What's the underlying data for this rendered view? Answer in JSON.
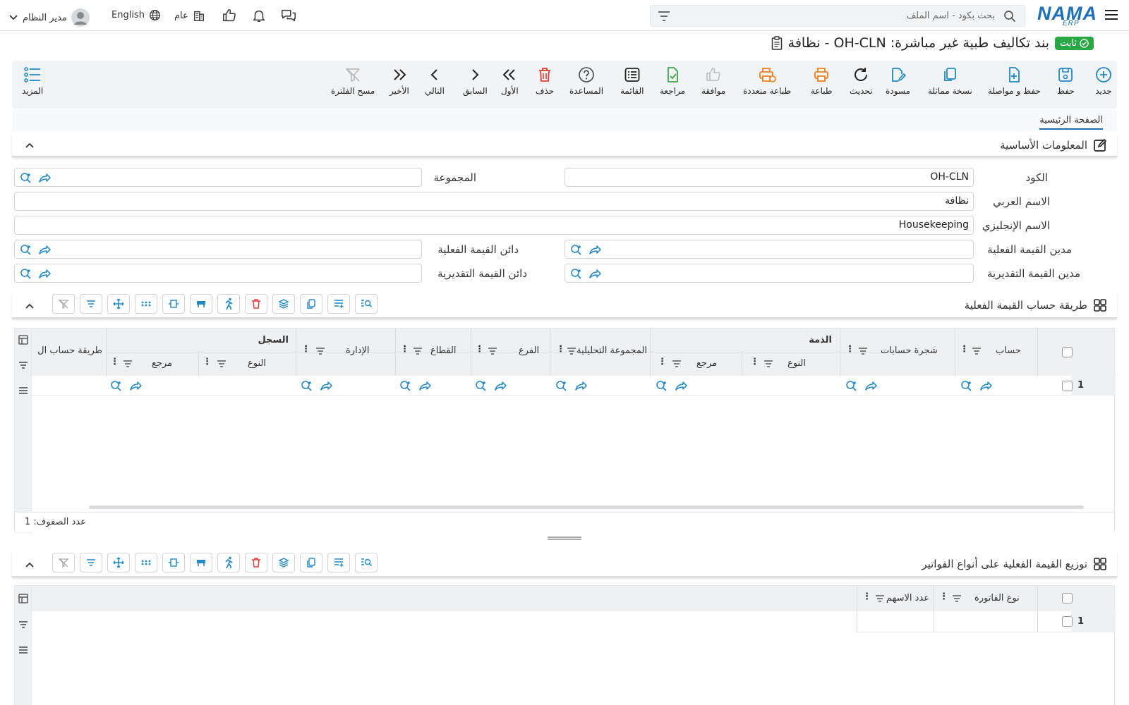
{
  "topbar": {
    "user": "مدير النظام",
    "language": "English",
    "branch": "عام",
    "search_placeholder": "بحث بكود - اسم الملف",
    "logo": "NAMA",
    "logo_sub": "ERP"
  },
  "page": {
    "title": "بند تكاليف طبية غير مباشرة: OH-CLN - نظافة",
    "status": "ثابت"
  },
  "toolbar": {
    "new": "جديد",
    "save": "حفظ",
    "save_continue": "حفظ و مواصلة",
    "duplicate": "نسخة مماثلة",
    "draft": "مسودة",
    "refresh": "تحديث",
    "print": "طباعة",
    "multi_print": "طباعة متعددة",
    "approve": "موافقة",
    "review": "مراجعة",
    "list": "القائمة",
    "help": "المساعدة",
    "delete": "حذف",
    "first": "الأول",
    "previous": "السابق",
    "next": "التالي",
    "last": "الأخير",
    "clear_filter": "مسح الفلترة",
    "more": "المزيد"
  },
  "tabs": {
    "main": "الصفحة الرئيسية"
  },
  "basic": {
    "title": "المعلومات الأساسية",
    "code_label": "الكود",
    "code_value": "OH-CLN",
    "group_label": "المجموعة",
    "arabic_name_label": "الاسم العربي",
    "arabic_name_value": "نظافة",
    "english_name_label": "الاسم الإنجليزي",
    "english_name_value": "Housekeeping",
    "actual_debit_label": "مدين القيمة الفعلية",
    "actual_credit_label": "دائن القيمة الفعلية",
    "estimated_debit_label": "مدين القيمة التقديرية",
    "estimated_credit_label": "دائن القيمة التقديرية"
  },
  "section1": {
    "title": "طريقة حساب القيمة الفعلية",
    "group_dhimma": "الذمة",
    "group_record": "السجل",
    "columns": {
      "account": "حساب",
      "account_tree": "شجرة حسابات",
      "type": "النوع",
      "ref": "مرجع",
      "analytic_group": "المجموعة التحليلية",
      "branch": "الفرع",
      "sector": "القطاع",
      "department": "الإدارة",
      "calc_method": "طريقة حساب ال"
    },
    "row_number": "1",
    "row_count": "عدد الصفوف: 1"
  },
  "section2": {
    "title": "توزيع القيمة الفعلية على أنواع الفواتير",
    "columns": {
      "invoice_type": "نوع الفاتورة",
      "shares": "عدد الاسهم"
    },
    "row_number": "1"
  },
  "colors": {
    "brand": "#1d6fb8",
    "status_green": "#28a745",
    "icon_blue": "#1f88c9",
    "icon_orange": "#f07f1a",
    "icon_green": "#3aa64a",
    "icon_red": "#e53935"
  }
}
